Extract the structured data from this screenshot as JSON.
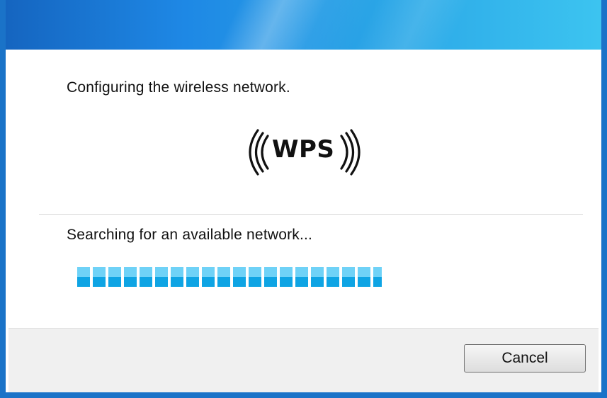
{
  "dialog": {
    "heading": "Configuring the wireless network.",
    "logo_text": "WPS",
    "status_text": "Searching for an available network...",
    "progress_segments_filled": 20,
    "cancel_label": "Cancel"
  },
  "colors": {
    "titlebar_start": "#1565c0",
    "titlebar_end": "#3cc4f0",
    "progress_light": "#6fd2f7",
    "progress_dark": "#0ea4e4"
  },
  "icons": {
    "logo": "wps-logo-icon"
  }
}
